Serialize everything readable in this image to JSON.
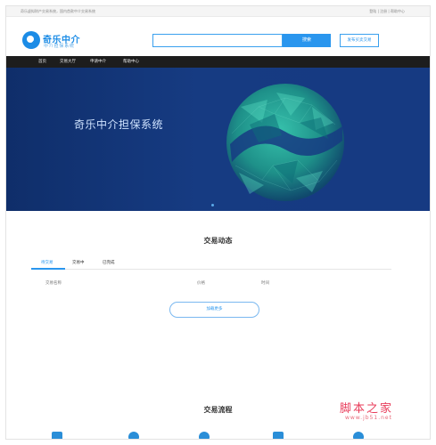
{
  "topbar": {
    "left_text": "奇乐虚拟财产交易系统，国内首款中介交易系统",
    "right_text": "登陆 | 注册 | 帮助中心"
  },
  "header": {
    "logo_title": "奇乐中介",
    "logo_subtitle": "中介担保系统",
    "search_placeholder": "",
    "search_button": "搜索",
    "publish_button": "发布买卖交易"
  },
  "nav": {
    "items": [
      {
        "label": "首页"
      },
      {
        "label": "交易大厅"
      },
      {
        "label": "申请中介"
      },
      {
        "label": "帮助中心"
      }
    ]
  },
  "banner": {
    "title": "奇乐中介担保系统"
  },
  "trade_activity": {
    "title": "交易动态",
    "tabs": [
      {
        "label": "待交易",
        "active": true
      },
      {
        "label": "交易中",
        "active": false
      },
      {
        "label": "已完成",
        "active": false
      }
    ],
    "columns": [
      "交易名称",
      "价格",
      "时间"
    ],
    "load_more": "加载更多"
  },
  "trade_flow": {
    "title": "交易流程"
  },
  "watermark": {
    "main": "脚本之家",
    "url": "www.jb51.net"
  },
  "colors": {
    "accent": "#2a96ee",
    "nav_bg": "#1d1d1d",
    "banner_bg": "#163b82",
    "sphere": "#27b89c"
  }
}
